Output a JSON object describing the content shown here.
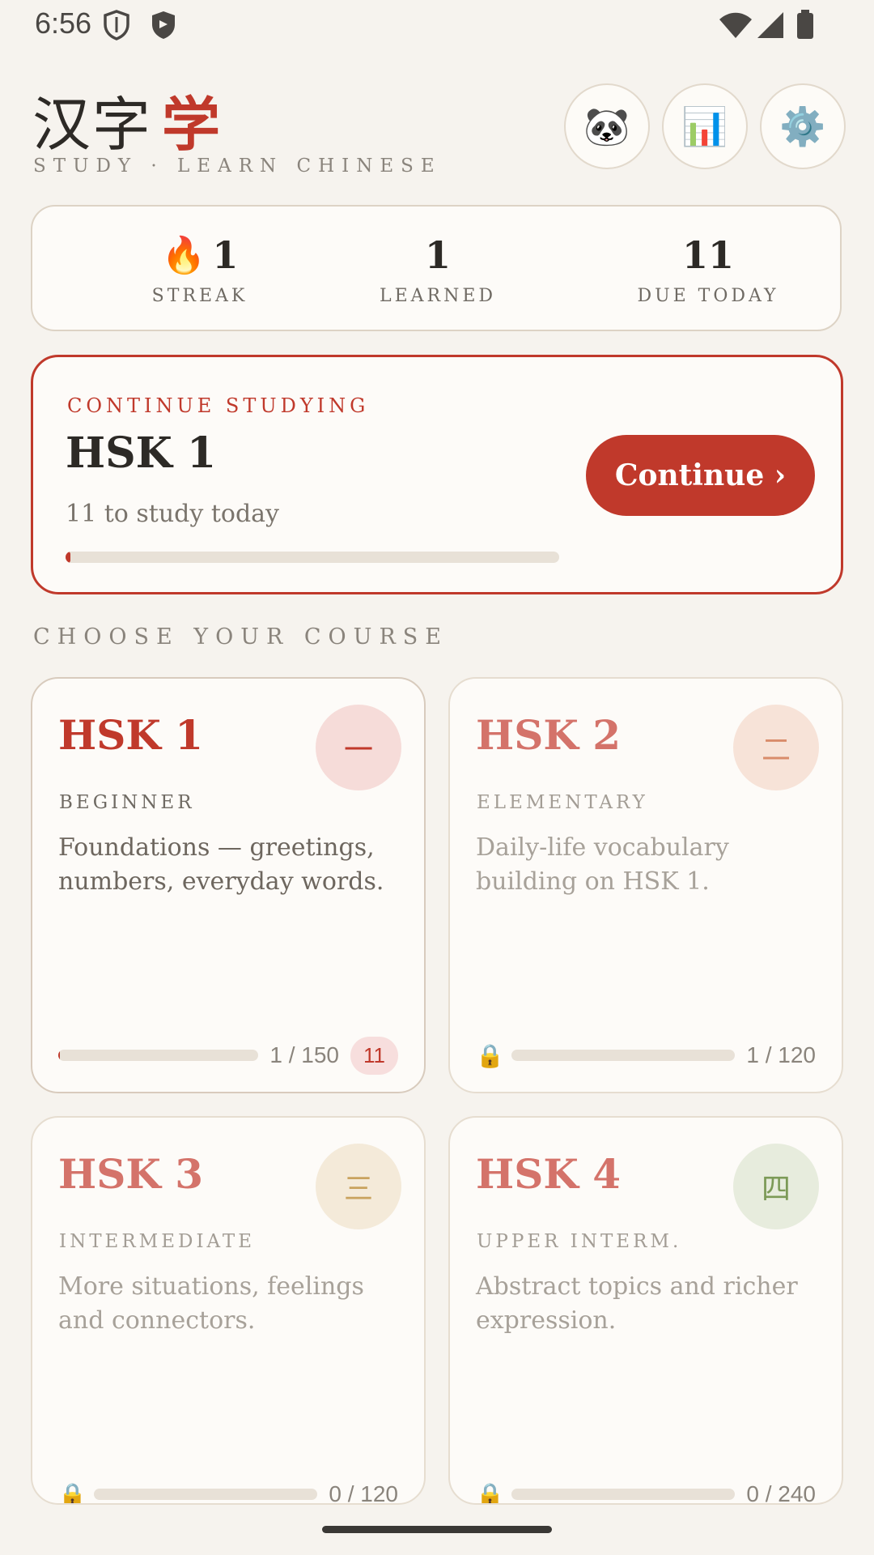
{
  "status_bar": {
    "time": "6:56",
    "icons": [
      "shield-outline-icon",
      "shield-filled-icon",
      "wifi-icon",
      "signal-icon",
      "battery-icon"
    ]
  },
  "header": {
    "title_main": "汉字",
    "title_accent": "学",
    "subtitle": "STUDY · LEARN CHINESE",
    "buttons": [
      {
        "name": "profile-button",
        "icon": "🐼",
        "icon_name": "panda-icon"
      },
      {
        "name": "stats-button",
        "icon": "📊",
        "icon_name": "bar-chart-icon"
      },
      {
        "name": "settings-button",
        "icon": "⚙️",
        "icon_name": "gear-icon"
      }
    ]
  },
  "stats": {
    "streak": {
      "icon": "🔥",
      "value": "1",
      "label": "STREAK"
    },
    "learned": {
      "value": "1",
      "label": "LEARNED"
    },
    "due": {
      "value": "11",
      "label": "DUE TODAY"
    }
  },
  "continue_card": {
    "kicker": "CONTINUE STUDYING",
    "title": "HSK 1",
    "subtitle": "11 to study today",
    "progress": 0.01,
    "button_label": "Continue ›"
  },
  "section_title": "CHOOSE YOUR COURSE",
  "courses": [
    {
      "title": "HSK 1",
      "glyph": "一",
      "level": "BEGINNER",
      "description": "Foundations — greetings, numbers, everyday words.",
      "count": "1 / 150",
      "progress": 0.0067,
      "due": "11",
      "locked": false,
      "badge_bg": "#f6dcd9",
      "badge_fg": "#c0392b"
    },
    {
      "title": "HSK 2",
      "glyph": "二",
      "level": "ELEMENTARY",
      "description": "Daily-life vocabulary building on HSK 1.",
      "count": "1 / 120",
      "progress": 0,
      "locked": true,
      "badge_bg": "#f7e3d8",
      "badge_fg": "#d98c6b"
    },
    {
      "title": "HSK 3",
      "glyph": "三",
      "level": "INTERMEDIATE",
      "description": "More situations, feelings and connectors.",
      "count": "0 / 120",
      "progress": 0,
      "locked": true,
      "badge_bg": "#f4ead9",
      "badge_fg": "#c9a35f"
    },
    {
      "title": "HSK 4",
      "glyph": "四",
      "level": "UPPER INTERM.",
      "description": "Abstract topics and richer expression.",
      "count": "0 / 240",
      "progress": 0,
      "locked": true,
      "badge_bg": "#e7ecdd",
      "badge_fg": "#7c9a57"
    }
  ],
  "lock_icon": "🔒",
  "colors": {
    "accent": "#c0392b",
    "background": "#f6f3ee",
    "card": "#fdfbf8"
  }
}
